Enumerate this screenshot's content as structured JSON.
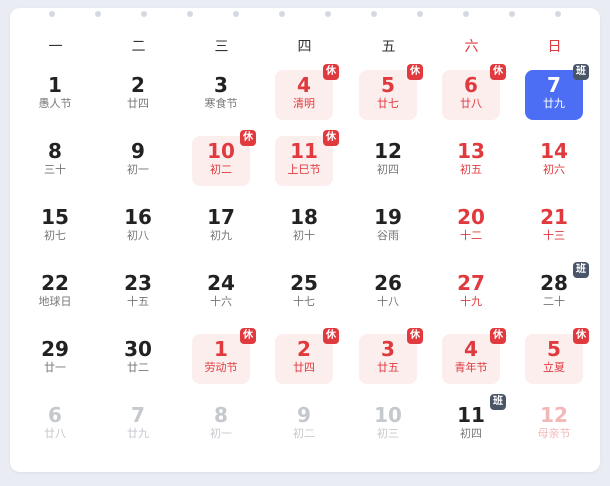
{
  "weekdays": [
    "一",
    "二",
    "三",
    "四",
    "五",
    "六",
    "日"
  ],
  "colors": {
    "holiday_red": "#e0393e",
    "today_blue": "#4b6ef5",
    "rest_bg": "#fdeeee",
    "work_badge": "#4a5568"
  },
  "badge_labels": {
    "rest": "休",
    "work": "班"
  },
  "weeks": [
    [
      {
        "day": "1",
        "sub": "愚人节"
      },
      {
        "day": "2",
        "sub": "廿四"
      },
      {
        "day": "3",
        "sub": "寒食节"
      },
      {
        "day": "4",
        "sub": "清明",
        "rest": true,
        "badge": "rest"
      },
      {
        "day": "5",
        "sub": "廿七",
        "rest": true,
        "badge": "rest"
      },
      {
        "day": "6",
        "sub": "廿八",
        "rest": true,
        "badge": "rest"
      },
      {
        "day": "7",
        "sub": "廿九",
        "today": true,
        "badge": "work"
      }
    ],
    [
      {
        "day": "8",
        "sub": "三十"
      },
      {
        "day": "9",
        "sub": "初一"
      },
      {
        "day": "10",
        "sub": "初二",
        "rest": true,
        "badge": "rest"
      },
      {
        "day": "11",
        "sub": "上巳节",
        "rest": true,
        "badge": "rest"
      },
      {
        "day": "12",
        "sub": "初四"
      },
      {
        "day": "13",
        "sub": "初五",
        "red": true
      },
      {
        "day": "14",
        "sub": "初六",
        "red": true
      }
    ],
    [
      {
        "day": "15",
        "sub": "初七"
      },
      {
        "day": "16",
        "sub": "初八"
      },
      {
        "day": "17",
        "sub": "初九"
      },
      {
        "day": "18",
        "sub": "初十"
      },
      {
        "day": "19",
        "sub": "谷雨"
      },
      {
        "day": "20",
        "sub": "十二",
        "red": true
      },
      {
        "day": "21",
        "sub": "十三",
        "red": true
      }
    ],
    [
      {
        "day": "22",
        "sub": "地球日"
      },
      {
        "day": "23",
        "sub": "十五"
      },
      {
        "day": "24",
        "sub": "十六"
      },
      {
        "day": "25",
        "sub": "十七"
      },
      {
        "day": "26",
        "sub": "十八"
      },
      {
        "day": "27",
        "sub": "十九",
        "red": true
      },
      {
        "day": "28",
        "sub": "二十",
        "badge": "work"
      }
    ],
    [
      {
        "day": "29",
        "sub": "廿一"
      },
      {
        "day": "30",
        "sub": "廿二"
      },
      {
        "day": "1",
        "sub": "劳动节",
        "rest": true,
        "badge": "rest"
      },
      {
        "day": "2",
        "sub": "廿四",
        "rest": true,
        "badge": "rest"
      },
      {
        "day": "3",
        "sub": "廿五",
        "rest": true,
        "badge": "rest"
      },
      {
        "day": "4",
        "sub": "青年节",
        "rest": true,
        "badge": "rest"
      },
      {
        "day": "5",
        "sub": "立夏",
        "rest": true,
        "badge": "rest"
      }
    ],
    [
      {
        "day": "6",
        "sub": "廿八",
        "muted": true
      },
      {
        "day": "7",
        "sub": "廿九",
        "muted": true
      },
      {
        "day": "8",
        "sub": "初一",
        "muted": true
      },
      {
        "day": "9",
        "sub": "初二",
        "muted": true
      },
      {
        "day": "10",
        "sub": "初三",
        "muted": true
      },
      {
        "day": "11",
        "sub": "初四",
        "badge": "work"
      },
      {
        "day": "12",
        "sub": "母亲节",
        "muted_red": true
      }
    ]
  ]
}
